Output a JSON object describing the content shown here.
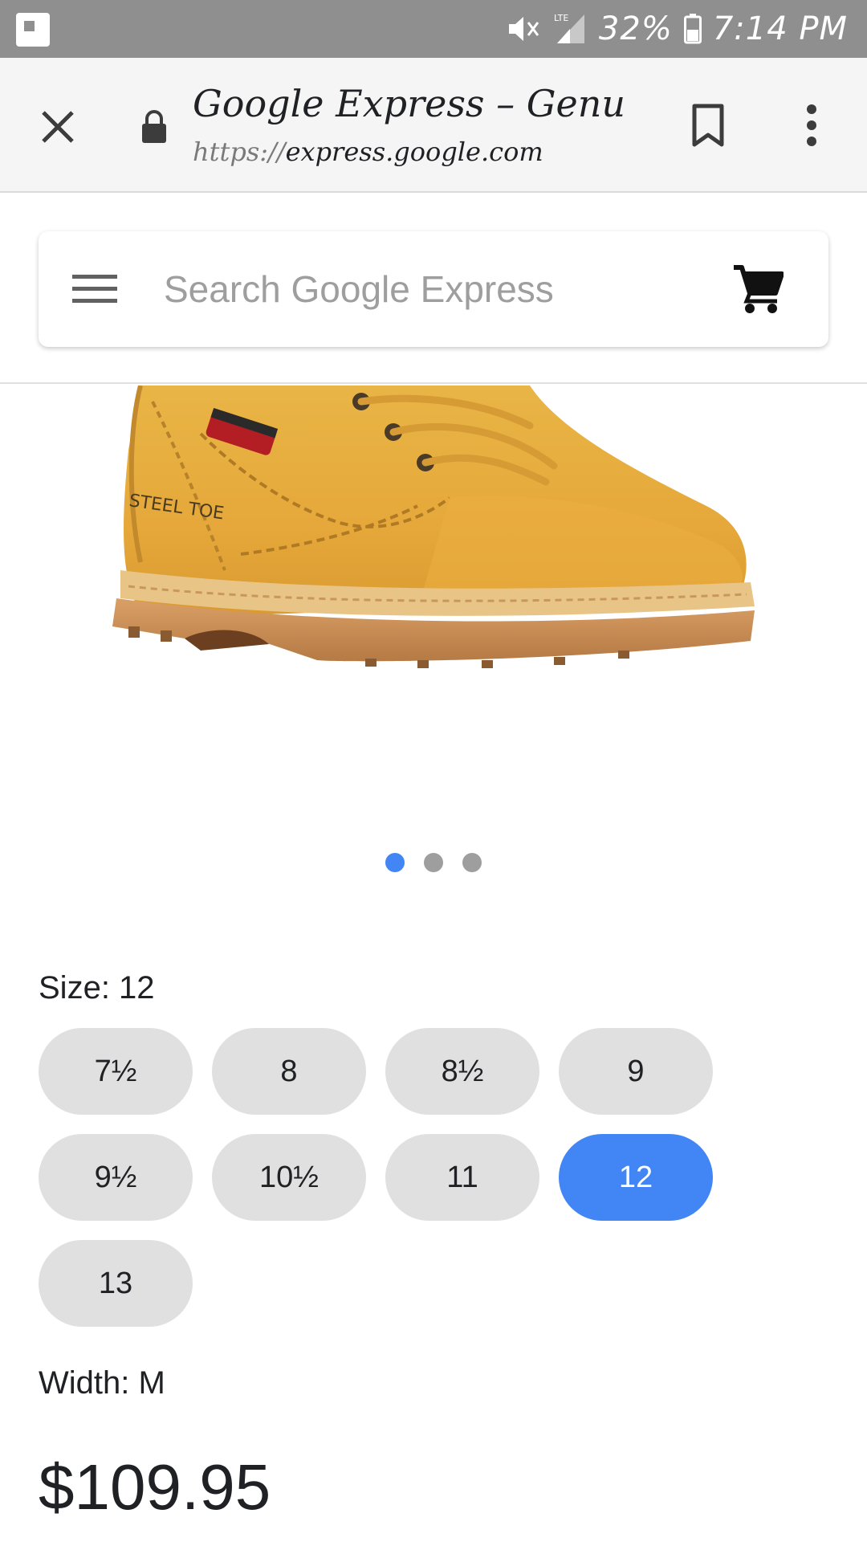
{
  "status_bar": {
    "battery": "32%",
    "time": "7:14 PM",
    "network": "LTE",
    "icons": [
      "app-notification-icon",
      "mute-icon",
      "signal-icon",
      "battery-icon"
    ]
  },
  "toolbar": {
    "title": "Google Express – Genui...",
    "url_scheme": "https://",
    "url_host": "express.google.com",
    "icons": [
      "close-icon",
      "lock-icon",
      "bookmark-icon",
      "more-vert-icon"
    ]
  },
  "search": {
    "placeholder": "Search Google Express",
    "icons": [
      "menu-icon",
      "cart-icon"
    ]
  },
  "product": {
    "image_name": "work-boot-image",
    "carousel": {
      "count": 3,
      "active_index": 0
    },
    "size_label": "Size: 12",
    "sizes": [
      "7½",
      "8",
      "8½",
      "9",
      "9½",
      "10½",
      "11",
      "12",
      "13"
    ],
    "selected_size": "12",
    "width_label": "Width: M",
    "price": "$109.95"
  },
  "colors": {
    "accent": "#4285f4",
    "chip_bg": "#e0e0e0",
    "status_bar": "#8f8f8f",
    "toolbar_bg": "#f5f5f5"
  }
}
